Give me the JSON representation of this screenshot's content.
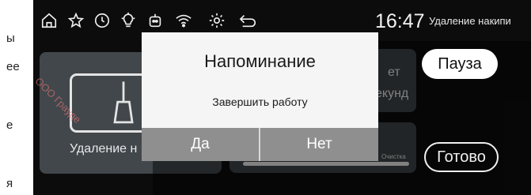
{
  "edge_fragments": [
    "ы",
    "ее",
    "е",
    "я"
  ],
  "status_bar": {
    "icons": [
      "home-icon",
      "star-icon",
      "clock-icon",
      "bulb-icon",
      "robot-icon",
      "wifi-icon",
      "gear-icon",
      "back-arrow-icon"
    ],
    "time": "16:47",
    "mode_title": "Удаление накипи"
  },
  "cards": {
    "left_label": "Удаление н",
    "right1_line1": "ет",
    "right1_line2": "екунд",
    "right2_label": "Очистка"
  },
  "buttons": {
    "pause": "Пауза",
    "done": "Готово"
  },
  "dialog": {
    "title": "Напоминание",
    "message": "Завершить работу",
    "yes": "Да",
    "no": "Нет"
  },
  "watermark": "ООО Грауде",
  "colors": {
    "screen_bg": "#0c0c0c",
    "card_bg": "#3e4448",
    "dialog_bg": "#f5f5f5",
    "dialog_button_bg": "#8f8f8f"
  }
}
